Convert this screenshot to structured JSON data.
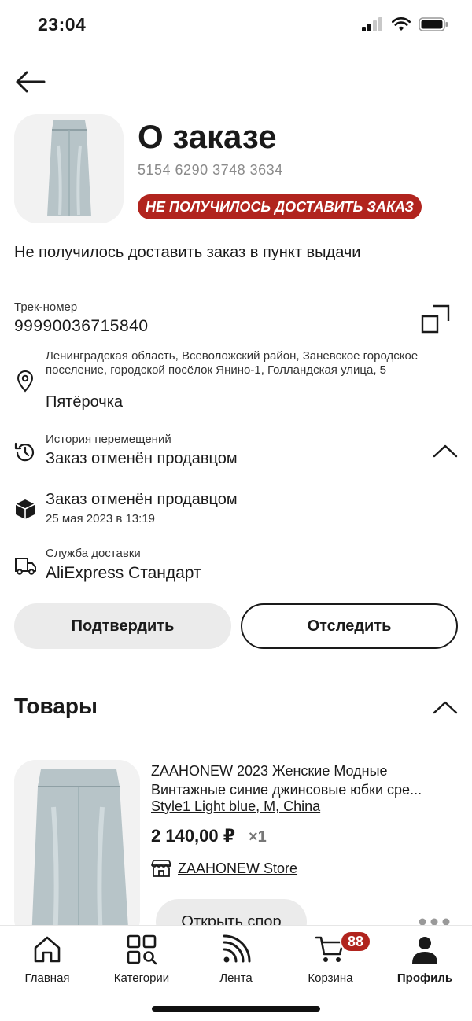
{
  "status_bar": {
    "time": "23:04"
  },
  "header": {
    "title": "О заказе",
    "order_number": "5154 6290 3748 3634",
    "status_badge": "НЕ ПОЛУЧИЛОСЬ ДОСТАВИТЬ ЗАКАЗ",
    "description": "Не получилось доставить заказ в пункт выдачи"
  },
  "tracking": {
    "label": "Трек-номер",
    "number": "99990036715840"
  },
  "address": {
    "line": "Ленинградская область, Всеволожский район, Заневское городское поселение, городской посёлок Янино-1, Голландская улица, 5",
    "pickup_point": "Пятёрочка"
  },
  "history": {
    "label": "История перемещений",
    "latest_status": "Заказ отменён продавцом",
    "events": [
      {
        "status": "Заказ отменён продавцом",
        "date": "25 мая 2023 в 13:19"
      }
    ]
  },
  "delivery": {
    "label": "Служба доставки",
    "service": "AliExpress Стандарт"
  },
  "actions": {
    "confirm_label": "Подтвердить",
    "track_label": "Отследить"
  },
  "products": {
    "title": "Товары",
    "items": [
      {
        "name_line1": "ZAAHONEW 2023 Женские Модные",
        "name_line2": "Винтажные синие джинсовые юбки сре...",
        "variant": "Style1 Light blue, M, China",
        "price": "2 140,00 ₽",
        "quantity": "×1",
        "store": "ZAAHONEW Store",
        "dispute_label": "Открыть спор"
      }
    ]
  },
  "tabbar": {
    "items": [
      {
        "label": "Главная",
        "icon": "home-icon"
      },
      {
        "label": "Категории",
        "icon": "categories-icon"
      },
      {
        "label": "Лента",
        "icon": "feed-icon"
      },
      {
        "label": "Корзина",
        "icon": "cart-icon",
        "badge": "88"
      },
      {
        "label": "Профиль",
        "icon": "profile-icon",
        "active": true
      }
    ]
  },
  "colors": {
    "accent": "#b1241e",
    "text": "#1a1a1a",
    "muted": "#8a8a8a",
    "button_bg": "#ebebeb"
  }
}
